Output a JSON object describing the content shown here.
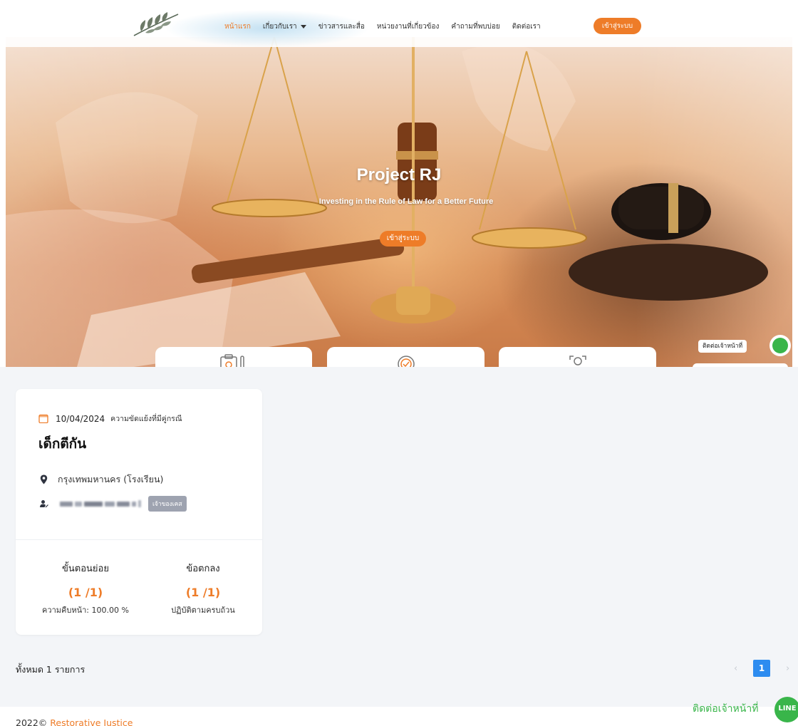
{
  "nav": {
    "links": [
      {
        "label": "หน้าแรก",
        "active": true
      },
      {
        "label": "เกี่ยวกับเรา",
        "dropdown": true
      },
      {
        "label": "ข่าวสารและสื่อ"
      },
      {
        "label": "หน่วยงานที่เกี่ยวข้อง"
      },
      {
        "label": "คำถามที่พบบ่อย"
      },
      {
        "label": "ติดต่อเรา"
      }
    ],
    "login_label": "เข้าสู่ระบบ",
    "logo_icon": "olive-branch-logo"
  },
  "hero": {
    "title": "Project RJ",
    "subtitle": "Investing in the Rule of Law for a Better Future",
    "button_label": "เข้าสู่ระบบ",
    "contact_label": "ติดต่อเจ้าหน้าที่",
    "feature_icons": [
      "clipboard-gear-icon",
      "checkmark-badge-icon",
      "person-frame-icon"
    ]
  },
  "case_card": {
    "date": "10/04/2024",
    "case_type": "ความขัดแย้งที่มีคู่กรณี",
    "title": "เด็กตีกัน",
    "location": "กรุงเทพมหานคร (โรงเรียน)",
    "owner_badge": "เจ้าของเคส",
    "stats": [
      {
        "label": "ขั้นตอนย่อย",
        "value": "(1 /1)",
        "note": "ความคืบหน้า: 100.00 %"
      },
      {
        "label": "ข้อตกลง",
        "value": "(1 /1)",
        "note": "ปฏิบัติตามครบถ้วน"
      }
    ]
  },
  "list": {
    "total_text": "ทั้งหมด 1 รายการ",
    "current_page": "1",
    "prev_symbol": "‹",
    "next_symbol": "›"
  },
  "footer": {
    "year": "2022©",
    "brand": "Restorative Justice",
    "contact_label": "ติดต่อเจ้าหน้าที่",
    "line_label": "LINE"
  },
  "colors": {
    "accent": "#ee7c28",
    "line_green": "#39b54a",
    "page_blue": "#2d8cf0"
  }
}
